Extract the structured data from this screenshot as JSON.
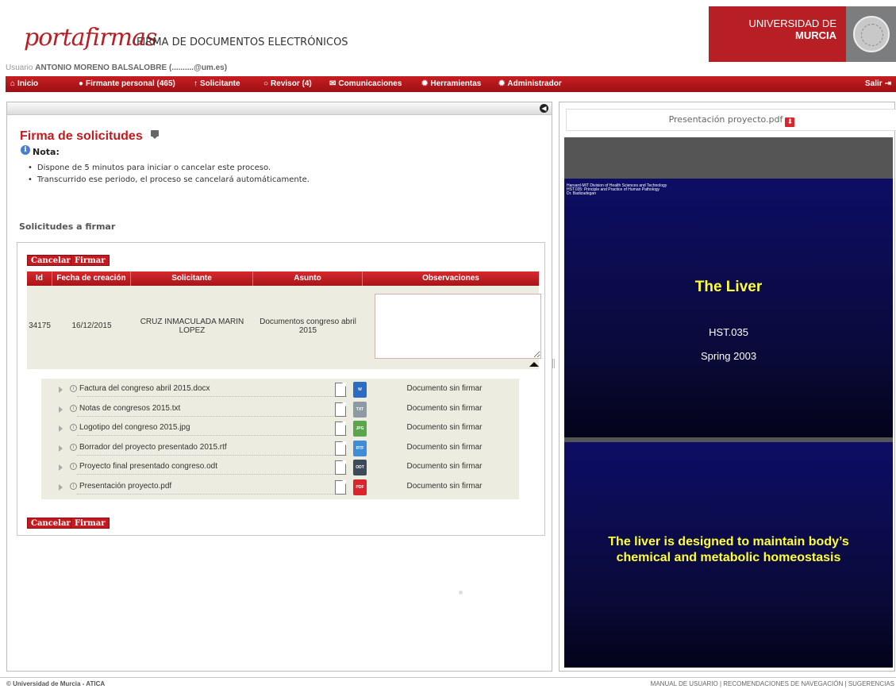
{
  "header": {
    "logo": "portafirmas",
    "app_title": "FIRMA DE DOCUMENTOS ELECTRÓNICOS",
    "university_line1": "UNIVERSIDAD DE",
    "university_line2": "MURCIA"
  },
  "user": {
    "prefix": "Usuario ",
    "name": "ANTONIO MORENO BALSALOBRE (..........@um.es)"
  },
  "nav": {
    "inicio": "Inicio",
    "firmante": "Firmante personal (465)",
    "solicitante": "Solicitante",
    "revisor": "Revisor (4)",
    "comunicaciones": "Comunicaciones",
    "herramientas": "Herramientas",
    "administrador": "Administrador",
    "salir": "Salir"
  },
  "main": {
    "title": "Firma de solicitudes",
    "nota_label": "Nota:",
    "bullets": [
      "Dispone de 5 minutos para iniciar o cancelar este proceso.",
      "Transcurrido ese periodo, el proceso se cancelará automáticamente."
    ],
    "subtitle": "Solicitudes a firmar",
    "cancel_label": "Cancelar",
    "sign_label": "Firmar"
  },
  "table": {
    "headers": [
      "Id",
      "Fecha de creación",
      "Solicitante",
      "Asunto",
      "Observaciones"
    ],
    "row": {
      "id": "34175",
      "fecha": "16/12/2015",
      "solicitante_line1": "CRUZ INMACULADA MARIN",
      "solicitante_line2": "LOPEZ",
      "asunto_line1": "Documentos congreso abril",
      "asunto_line2": "2015",
      "observaciones": ""
    }
  },
  "documents": [
    {
      "name": "Factura del congreso abril 2015.docx",
      "type": "docx",
      "type_label": "W",
      "color": "#2b6cc4",
      "status": "Documento sin firmar"
    },
    {
      "name": "Notas de congresos 2015.txt",
      "type": "txt",
      "type_label": "TXT",
      "color": "#8e99a6",
      "status": "Documento sin firmar"
    },
    {
      "name": "Logotipo del congreso 2015.jpg",
      "type": "jpg",
      "type_label": "JPG",
      "color": "#5aa64b",
      "status": "Documento sin firmar"
    },
    {
      "name": "Borrador del proyecto presentado 2015.rtf",
      "type": "rtf",
      "type_label": "RTF",
      "color": "#3e8dd6",
      "status": "Documento sin firmar"
    },
    {
      "name": "Proyecto final presentado congreso.odt",
      "type": "odt",
      "type_label": "ODT",
      "color": "#3c4a5a",
      "status": "Documento sin firmar"
    },
    {
      "name": "Presentación proyecto.pdf",
      "type": "pdf",
      "type_label": "PDF",
      "color": "#d9262c",
      "status": "Documento sin firmar"
    }
  ],
  "preview": {
    "filename": "Presentación proyecto.pdf",
    "slide1": {
      "header_lines": [
        "Harvard-MIT Division of Health Sciences and Technology",
        "HST.035: Principle and Practice of Human Pathology",
        "Dr. Badizadegan"
      ],
      "title": "The Liver",
      "code": "HST.035",
      "term": "Spring 2003"
    },
    "slide2": {
      "text": "The liver is designed to maintain body’s chemical and metabolic homeostasis"
    }
  },
  "footer": {
    "copyright": "© Universidad de Murcia - ATICA",
    "links": "MANUAL DE USUARIO | RECOMENDACIONES DE NAVEGACIÓN | SUGERENCIAS"
  },
  "colors": {
    "brand_red": "#b71f24",
    "nav_red": "#c81e22",
    "slide_yellow": "#ffff33",
    "slide_blue": "#0d0d66"
  }
}
